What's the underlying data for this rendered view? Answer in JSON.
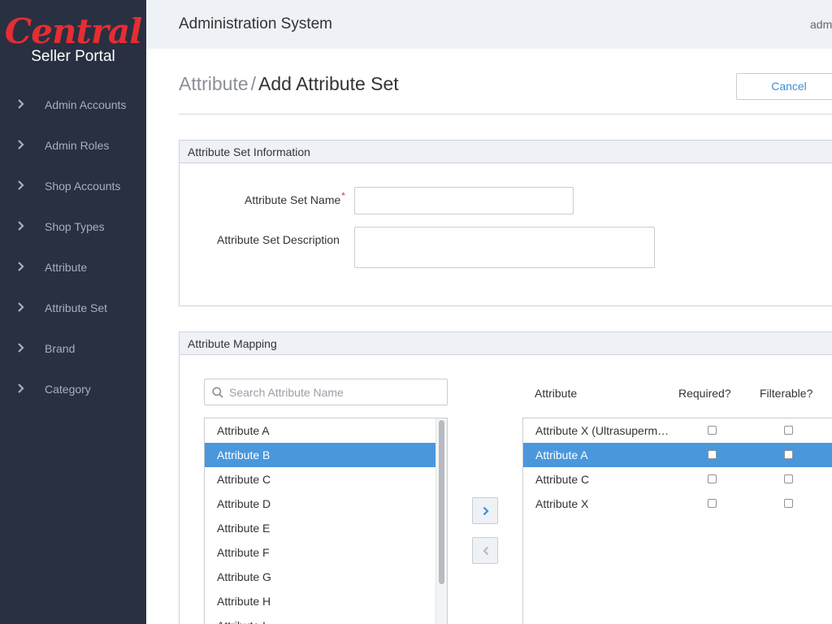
{
  "brand": {
    "logo_script": "Central",
    "logo_sub": "Seller Portal"
  },
  "sidebar": {
    "items": [
      {
        "label": "Admin Accounts"
      },
      {
        "label": "Admin Roles"
      },
      {
        "label": "Shop Accounts"
      },
      {
        "label": "Shop Types"
      },
      {
        "label": "Attribute"
      },
      {
        "label": "Attribute Set"
      },
      {
        "label": "Brand"
      },
      {
        "label": "Category"
      }
    ]
  },
  "header": {
    "title": "Administration System",
    "user": "adm"
  },
  "page": {
    "breadcrumb_parent": "Attribute",
    "breadcrumb_separator": "/",
    "title": "Add Attribute Set",
    "cancel_label": "Cancel"
  },
  "info_panel": {
    "title": "Attribute Set Information",
    "name_label": "Attribute Set Name",
    "required_mark": "*",
    "name_value": "",
    "description_label": "Attribute Set Description",
    "description_value": ""
  },
  "mapping_panel": {
    "title": "Attribute Mapping",
    "search_placeholder": "Search Attribute Name",
    "available": [
      {
        "label": "Attribute A",
        "selected": false
      },
      {
        "label": "Attribute B",
        "selected": true
      },
      {
        "label": "Attribute C",
        "selected": false
      },
      {
        "label": "Attribute D",
        "selected": false
      },
      {
        "label": "Attribute E",
        "selected": false
      },
      {
        "label": "Attribute F",
        "selected": false
      },
      {
        "label": "Attribute G",
        "selected": false
      },
      {
        "label": "Attribute H",
        "selected": false
      },
      {
        "label": "Attribute I",
        "selected": false
      }
    ],
    "columns": {
      "attribute": "Attribute",
      "required": "Required?",
      "filterable": "Filterable?"
    },
    "selected": [
      {
        "label": "Attribute X (Ultrasuperm…",
        "selected": false,
        "required": false,
        "filterable": false
      },
      {
        "label": "Attribute A",
        "selected": true,
        "required": false,
        "filterable": false
      },
      {
        "label": "Attribute C",
        "selected": false,
        "required": false,
        "filterable": false
      },
      {
        "label": "Attribute X",
        "selected": false,
        "required": false,
        "filterable": false
      }
    ]
  },
  "colors": {
    "sidebar_bg": "#283041",
    "brand_red": "#e52d33",
    "accent_blue": "#4a97dc",
    "link_blue": "#3d8fd6",
    "header_bg": "#eef2f7"
  },
  "icons": {
    "nav": "chevron-right-icon",
    "search": "search-icon",
    "move_right": "chevron-right-icon",
    "move_left": "chevron-left-icon"
  }
}
